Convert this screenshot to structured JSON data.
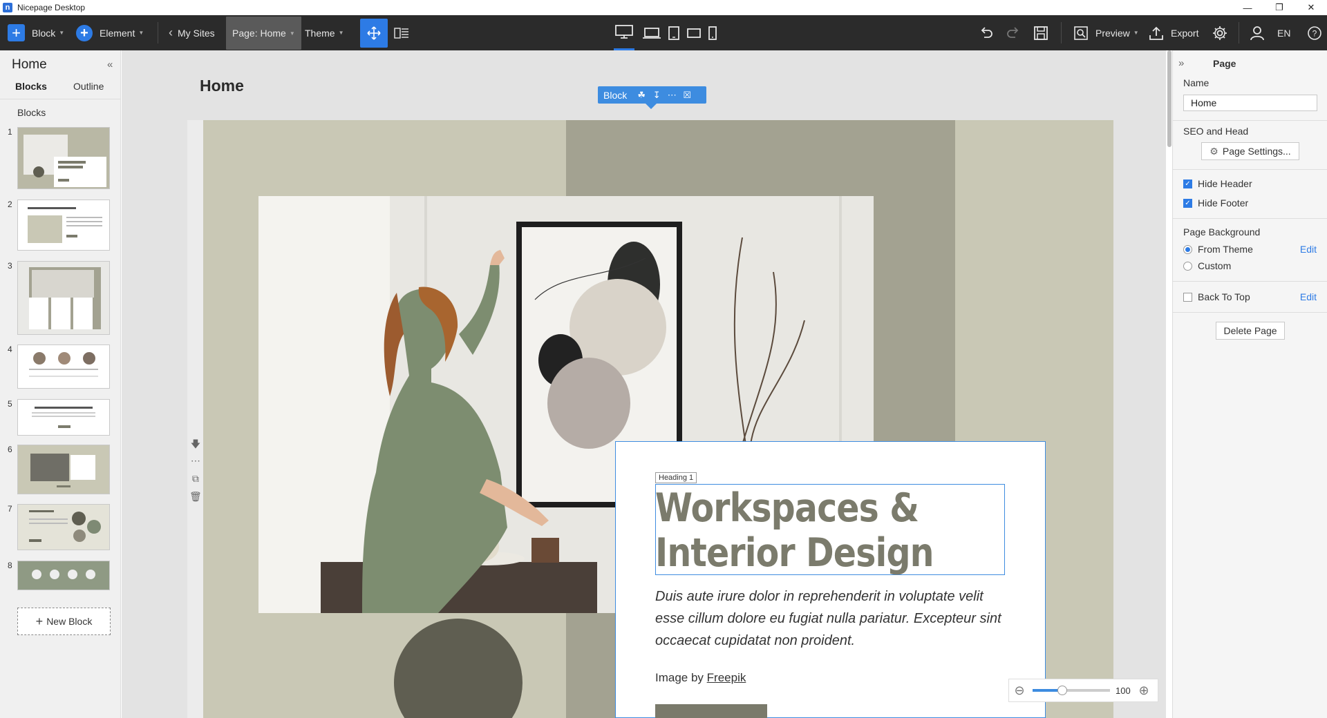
{
  "titlebar": {
    "logo": "n",
    "title": "Nicepage Desktop",
    "controls": [
      "minimize-icon",
      "restore-icon",
      "close-icon"
    ]
  },
  "toolbar": {
    "block_label": "Block",
    "element_label": "Element",
    "my_sites_label": "My Sites",
    "page_label": "Page: Home",
    "theme_label": "Theme",
    "preview_label": "Preview",
    "export_label": "Export",
    "language": "EN"
  },
  "left_panel": {
    "title": "Home",
    "tabs": [
      "Blocks",
      "Outline"
    ],
    "section_label": "Blocks",
    "thumbnails": [
      "1",
      "2",
      "3",
      "4",
      "5",
      "6",
      "7",
      "8"
    ],
    "new_block_label": "New Block"
  },
  "canvas": {
    "page_title": "Home",
    "block_toolbar_label": "Block",
    "heading_tag": "Heading 1",
    "heading_line1": "Workspaces &",
    "heading_line2": "Interior Design",
    "body": "Duis aute irure dolor in reprehenderit in voluptate velit esse cillum dolore eu fugiat nulla pariatur. Excepteur sint occaecat cupidatat non proident.",
    "credit_prefix": "Image by ",
    "credit_link": "Freepik",
    "zoom_value": "100",
    "zoom_fraction": 0.38
  },
  "right_panel": {
    "title": "Page",
    "name_label": "Name",
    "name_value": "Home",
    "seo_label": "SEO and Head",
    "page_settings_label": "Page Settings...",
    "hide_header_label": "Hide Header",
    "hide_header_checked": true,
    "hide_footer_label": "Hide Footer",
    "hide_footer_checked": true,
    "page_background_label": "Page Background",
    "from_theme_label": "From Theme",
    "custom_label": "Custom",
    "edit_label": "Edit",
    "back_to_top_label": "Back To Top",
    "back_to_top_checked": false,
    "delete_page_label": "Delete Page"
  },
  "colors": {
    "accent": "#2d7be5",
    "toolbar_bg": "#2b2b2b",
    "section_bg": "#c9c8b5",
    "section_dark": "#a3a291",
    "heading": "#7b7b6c",
    "circle": "#5f5e51"
  }
}
